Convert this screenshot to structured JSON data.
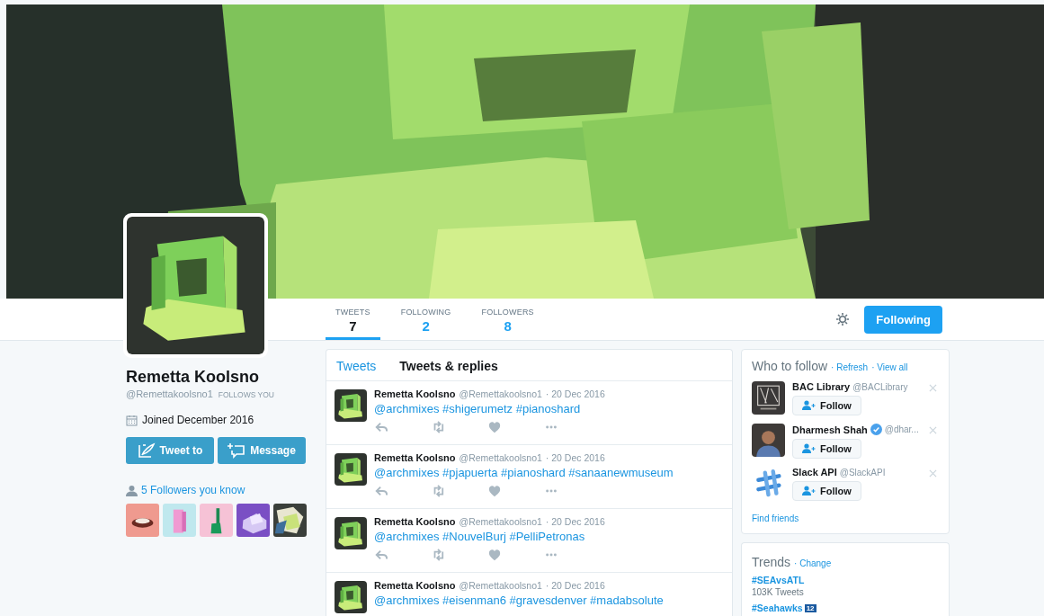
{
  "profile": {
    "name": "Remetta Koolsno",
    "handle": "@Remettakoolsno1",
    "follows_you": "FOLLOWS YOU",
    "joined": "Joined December 2016",
    "buttons": [
      {
        "kind": "tweet",
        "label": "Tweet to"
      },
      {
        "kind": "message",
        "label": "Message"
      }
    ],
    "followers_you_know": "5 Followers you know"
  },
  "stats": [
    {
      "label": "TWEETS",
      "value": "7",
      "selected": true
    },
    {
      "label": "FOLLOWING",
      "value": "2",
      "selected": false
    },
    {
      "label": "FOLLOWERS",
      "value": "8",
      "selected": false
    }
  ],
  "follow_button": "Following",
  "timeline": {
    "tabs": [
      {
        "label": "Tweets",
        "selected": false
      },
      {
        "label": "Tweets & replies",
        "selected": true
      }
    ],
    "tweets": [
      {
        "name": "Remetta Koolsno",
        "handle": "@Remettakoolsno1",
        "date": "· 20 Dec 2016",
        "text": "@archmixes #shigerumetz #pianoshard",
        "actions": true
      },
      {
        "name": "Remetta Koolsno",
        "handle": "@Remettakoolsno1",
        "date": "· 20 Dec 2016",
        "text": "@archmixes #pjapuerta #pianoshard #sanaanewmuseum",
        "actions": true
      },
      {
        "name": "Remetta Koolsno",
        "handle": "@Remettakoolsno1",
        "date": "· 20 Dec 2016",
        "text": "@archmixes #NouvelBurj #PelliPetronas",
        "actions": true
      },
      {
        "name": "Remetta Koolsno",
        "handle": "@Remettakoolsno1",
        "date": "· 20 Dec 2016",
        "text": "@archmixes #eisenman6 #gravesdenver #madabsolute",
        "actions": false
      }
    ]
  },
  "who_to_follow": {
    "title": "Who to follow",
    "refresh": "· Refresh",
    "view_all": "· View all",
    "accounts": [
      {
        "name": "BAC Library",
        "verified": false,
        "handle": "@BACLibrary",
        "button": "Follow",
        "kind": "picture"
      },
      {
        "name": "Dharmesh Shah",
        "verified": true,
        "handle": "@dhar...",
        "button": "Follow",
        "kind": "picture"
      },
      {
        "name": "Slack API",
        "verified": false,
        "handle": "@SlackAPI",
        "button": "Follow",
        "kind": "picture"
      }
    ],
    "find_friends": "Find friends"
  },
  "trends": {
    "title": "Trends",
    "change": "· Change",
    "items": [
      {
        "tag": "#SEAvsATL",
        "count": "103K Tweets"
      },
      {
        "tag": "#Seahawks",
        "badge": "12"
      }
    ]
  }
}
